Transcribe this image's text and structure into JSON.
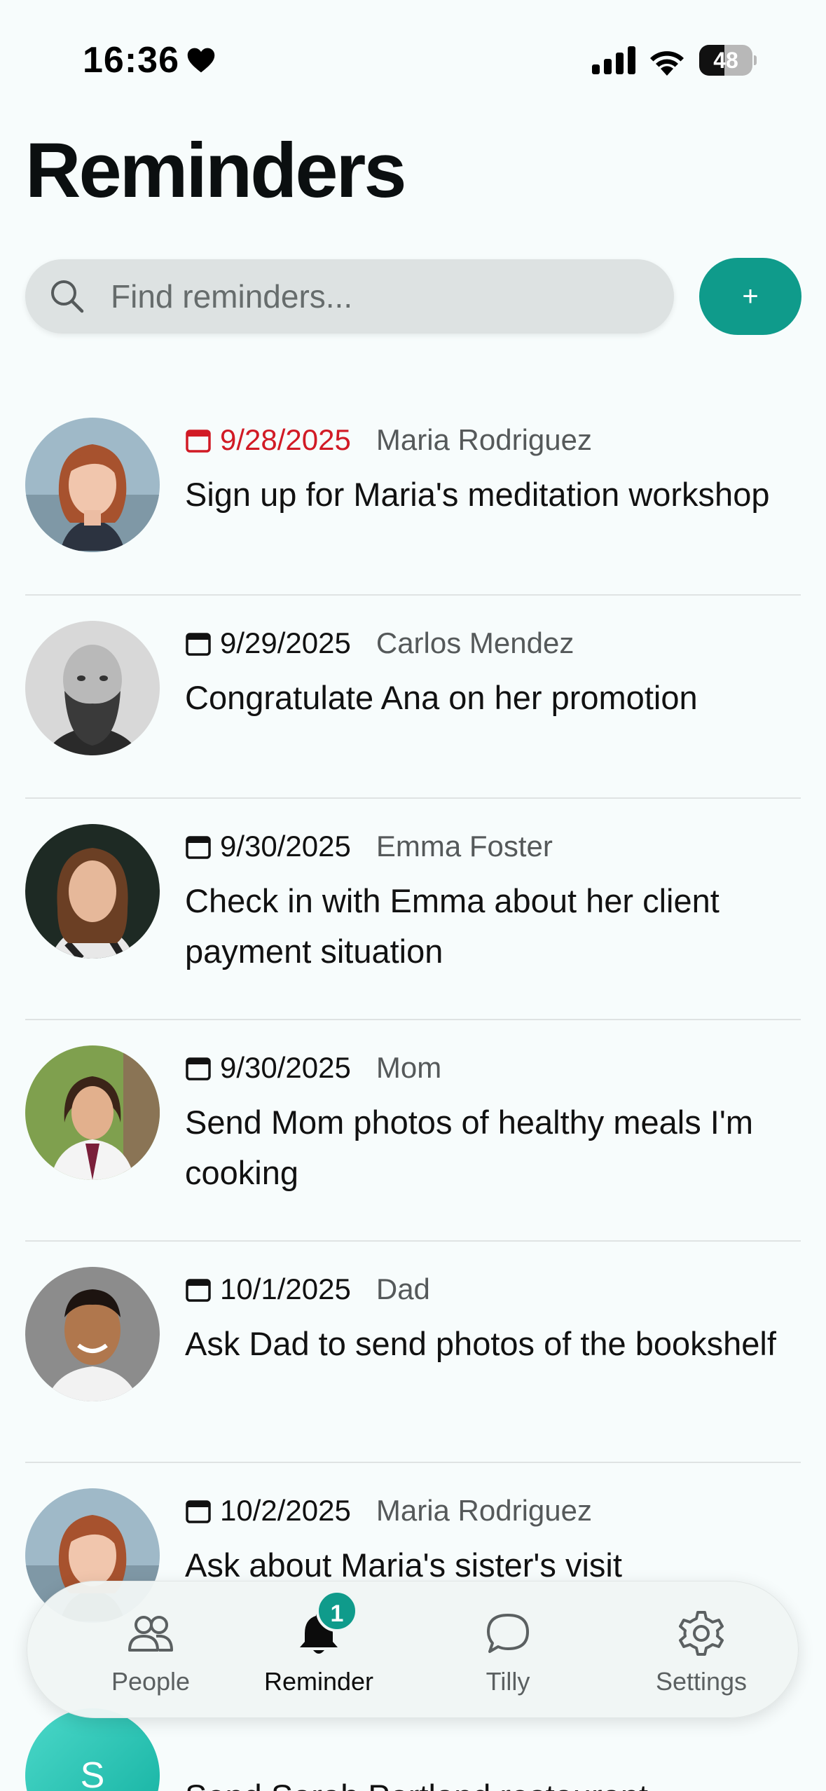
{
  "status_bar": {
    "time": "16:36",
    "battery": "48",
    "battery_level": 0.48
  },
  "header": {
    "title": "Reminders"
  },
  "search": {
    "placeholder": "Find reminders..."
  },
  "add_button": {
    "label": "+"
  },
  "reminders": [
    {
      "date": "9/28/2025",
      "person": "Maria Rodriguez",
      "text": "Sign up for Maria's meditation workshop",
      "overdue": true
    },
    {
      "date": "9/29/2025",
      "person": "Carlos Mendez",
      "text": "Congratulate Ana on her promotion"
    },
    {
      "date": "9/30/2025",
      "person": "Emma Foster",
      "text": "Check in with Emma about her client payment situation"
    },
    {
      "date": "9/30/2025",
      "person": "Mom",
      "text": "Send Mom photos of healthy meals I'm cooking"
    },
    {
      "date": "10/1/2025",
      "person": "Dad",
      "text": "Ask Dad to send photos of the bookshelf"
    },
    {
      "date": "10/2/2025",
      "person": "Maria Rodriguez",
      "text": "Ask about Maria's sister's visit"
    },
    {
      "avatar_initial": "S",
      "text": "Send Sarah Portland restaurant"
    }
  ],
  "tab_bar": {
    "tabs": [
      {
        "label": "People",
        "icon": "people-icon"
      },
      {
        "label": "Reminder",
        "icon": "bell-icon",
        "active": true,
        "badge": "1"
      },
      {
        "label": "Tilly",
        "icon": "chat-bubble-icon"
      },
      {
        "label": "Settings",
        "icon": "gear-icon"
      }
    ]
  },
  "colors": {
    "accent": "#0f9b8b",
    "overdue": "#d11a25",
    "background": "#f7fcfc"
  }
}
